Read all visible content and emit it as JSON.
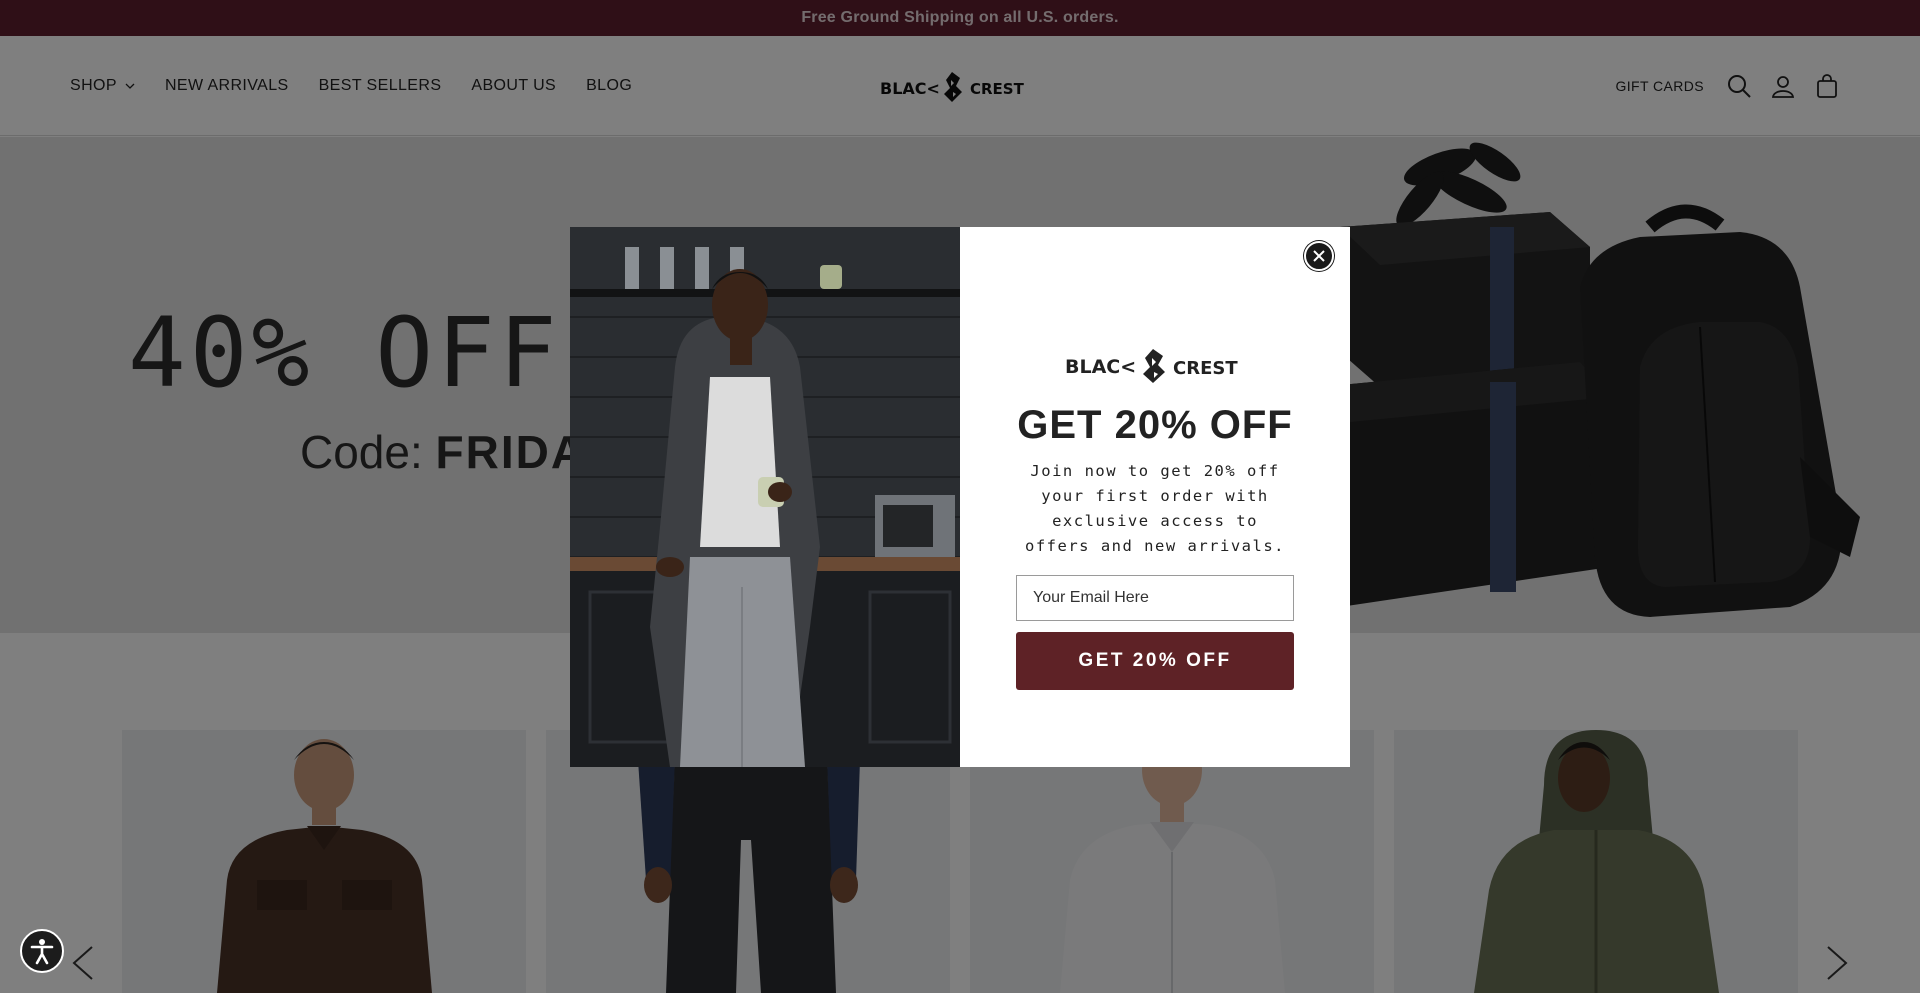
{
  "announcement": {
    "text": "Free Ground Shipping on all U.S. orders."
  },
  "header": {
    "nav": [
      {
        "label": "SHOP",
        "has_dropdown": true
      },
      {
        "label": "NEW ARRIVALS"
      },
      {
        "label": "BEST SELLERS"
      },
      {
        "label": "ABOUT US"
      },
      {
        "label": "BLOG"
      }
    ],
    "logo_text": "BLACK CREST",
    "gift_cards_label": "GIFT CARDS",
    "icons": [
      "search-icon",
      "account-icon",
      "cart-icon"
    ]
  },
  "hero": {
    "title": "40% OFF",
    "code_label": "Code:",
    "code_value": "FRIDA"
  },
  "popup": {
    "logo_text": "BLACK CREST",
    "title": "GET 20% OFF",
    "body": "Join now to get 20% off your first order with exclusive access to offers and new arrivals.",
    "email_placeholder": "Your Email Here",
    "email_value": "",
    "submit_label": "GET 20% OFF"
  },
  "colors": {
    "announcement_bg": "#5e1f2e",
    "cta_bg": "#5e2226",
    "overlay": "rgba(0,0,0,0.5)"
  }
}
